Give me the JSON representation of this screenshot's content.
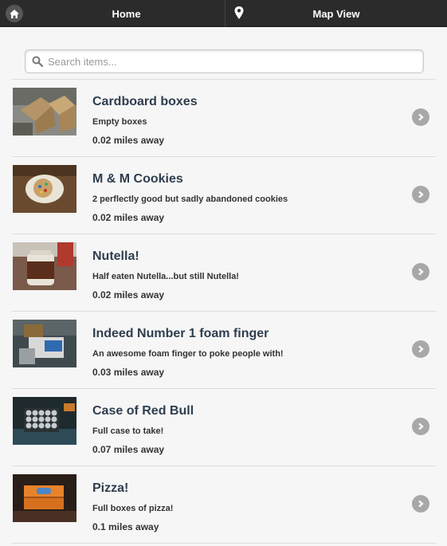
{
  "navbar": {
    "home_label": "Home",
    "map_label": "Map View",
    "home_icon": "home-icon",
    "map_icon": "map-pin-icon"
  },
  "search": {
    "placeholder": "Search items..."
  },
  "items": [
    {
      "title": "Cardboard boxes",
      "description": "Empty boxes",
      "distance": "0.02 miles away"
    },
    {
      "title": "M & M Cookies",
      "description": "2 perflectly good but sadly abandoned cookies",
      "distance": "0.02 miles away"
    },
    {
      "title": "Nutella!",
      "description": "Half eaten Nutella...but still Nutella!",
      "distance": "0.02 miles away"
    },
    {
      "title": "Indeed Number 1 foam finger",
      "description": "An awesome foam finger to poke people with!",
      "distance": "0.03 miles away"
    },
    {
      "title": "Case of Red Bull",
      "description": "Full case to take!",
      "distance": "0.07 miles away"
    },
    {
      "title": "Pizza!",
      "description": "Full boxes of pizza!",
      "distance": "0.1 miles away"
    }
  ],
  "colors": {
    "navbar_bg": "#2b2b2b",
    "page_bg": "#f6f6f6",
    "title_text": "#2f3e4e",
    "chevron_bg": "#a8a8a8"
  }
}
